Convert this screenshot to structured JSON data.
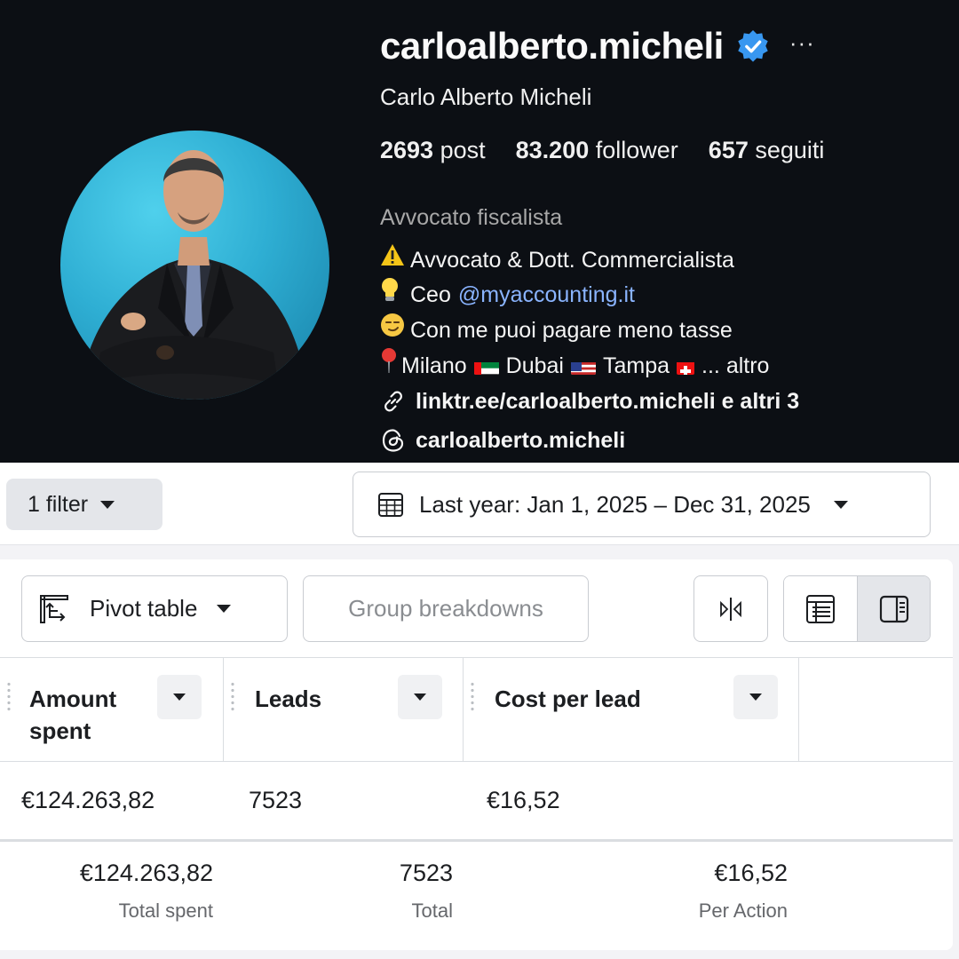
{
  "profile": {
    "handle": "carloalberto.micheli",
    "full_name": "Carlo Alberto Micheli",
    "stats": {
      "posts_value": "2693",
      "posts_label": "post",
      "followers_value": "83.200",
      "followers_label": "follower",
      "following_value": "657",
      "following_label": "seguiti"
    },
    "category": "Avvocato fiscalista",
    "bio": {
      "line1": "Avvocato & Dott. Commercialista",
      "line2_prefix": "Ceo",
      "line2_mention": "@myaccounting.it",
      "line3": "Con me puoi pagare meno tasse",
      "line4_city1": "Milano",
      "line4_city2": "Dubai",
      "line4_city3": "Tampa",
      "line4_more": "... altro"
    },
    "link_text": "linktr.ee/carloalberto.micheli e altri 3",
    "threads_text": "carloalberto.micheli",
    "accent_color": "#3897f0"
  },
  "filters": {
    "filter_label": "1 filter",
    "date_range": "Last year: Jan 1, 2025 – Dec 31, 2025"
  },
  "toolbar": {
    "pivot_label": "Pivot table",
    "group_label": "Group breakdowns"
  },
  "table": {
    "columns": [
      "Amount spent",
      "Leads",
      "Cost per lead"
    ],
    "row": [
      "€124.263,82",
      "7523",
      "€16,52"
    ],
    "totals": [
      {
        "value": "€124.263,82",
        "label": "Total spent"
      },
      {
        "value": "7523",
        "label": "Total"
      },
      {
        "value": "€16,52",
        "label": "Per Action"
      }
    ]
  }
}
